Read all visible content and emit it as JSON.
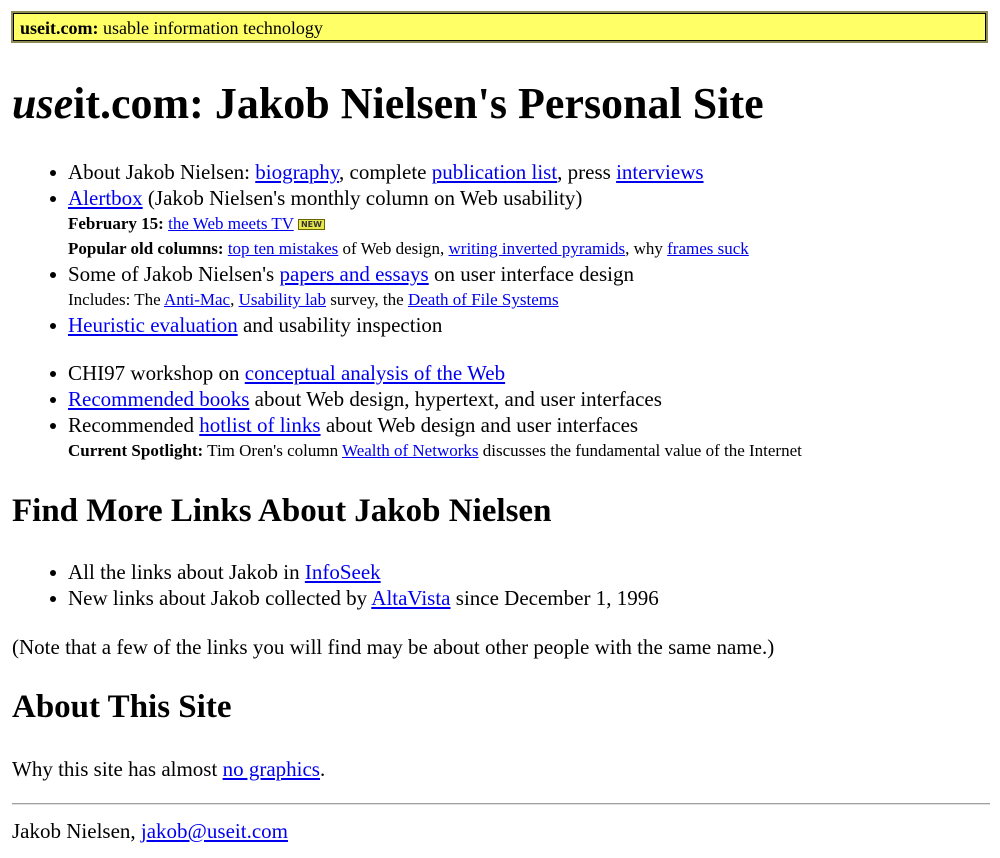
{
  "banner": {
    "site": "useit.com:",
    "tagline": " usable information technology"
  },
  "title": {
    "italic": "use",
    "rest": "it.com: Jakob Nielsen's Personal Site"
  },
  "list1": {
    "about": {
      "prefix": "About Jakob Nielsen: ",
      "bio": "biography",
      "sep1": ", complete ",
      "pubs": "publication list",
      "sep2": ", press ",
      "interviews": "interviews"
    },
    "alertbox": {
      "link": "Alertbox",
      "rest": " (Jakob Nielsen's monthly column on Web usability)",
      "date_label": "February 15:",
      "date_link": "the Web meets TV",
      "new_badge": "NEW",
      "popular_label": "Popular old columns:",
      "pop1": "top ten mistakes",
      "pop_mid1": " of Web design, ",
      "pop2": "writing inverted pyramids",
      "pop_mid2": ", why ",
      "pop3": "frames suck"
    },
    "papers": {
      "prefix": "Some of Jakob Nielsen's ",
      "link": "papers and essays",
      "rest": " on user interface design",
      "inc_prefix": "Includes: The ",
      "inc1": "Anti-Mac",
      "inc_sep1": ", ",
      "inc2": "Usability lab",
      "inc_sep2": " survey, the ",
      "inc3": "Death of File Systems"
    },
    "heuristic": {
      "link": "Heuristic evaluation",
      "rest": " and usability inspection"
    }
  },
  "list2": {
    "chi": {
      "prefix": "CHI97 workshop on ",
      "link": "conceptual analysis of the Web"
    },
    "books": {
      "link": "Recommended books",
      "rest": " about Web design, hypertext, and user interfaces"
    },
    "hotlist": {
      "prefix": "Recommended ",
      "link": "hotlist of links",
      "rest": " about Web design and user interfaces",
      "spot_label": "Current Spotlight:",
      "spot_prefix": " Tim Oren's column ",
      "spot_link": "Wealth of Networks",
      "spot_rest": " discusses the fundamental value of the Internet"
    }
  },
  "find": {
    "heading": "Find More Links About Jakob Nielsen",
    "infoseek": {
      "prefix": "All the links about Jakob in ",
      "link": "InfoSeek"
    },
    "altavista": {
      "prefix": "New links about Jakob collected by ",
      "link": "AltaVista",
      "rest": " since December 1, 1996"
    },
    "note": "(Note that a few of the links you will find may be about other people with the same name.)"
  },
  "about_site": {
    "heading": "About This Site",
    "prefix": "Why this site has almost ",
    "link": "no graphics",
    "suffix": "."
  },
  "footer": {
    "name": "Jakob Nielsen, ",
    "email": "jakob@useit.com"
  }
}
